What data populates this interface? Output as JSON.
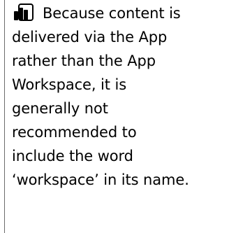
{
  "note": {
    "icon": "powerbi-icon",
    "lines": [
      "Because content is",
      "delivered via the App",
      "rather than the App",
      "Workspace, it is",
      "generally not",
      "recommended to",
      "include the word",
      "‘workspace’ in its name."
    ]
  }
}
